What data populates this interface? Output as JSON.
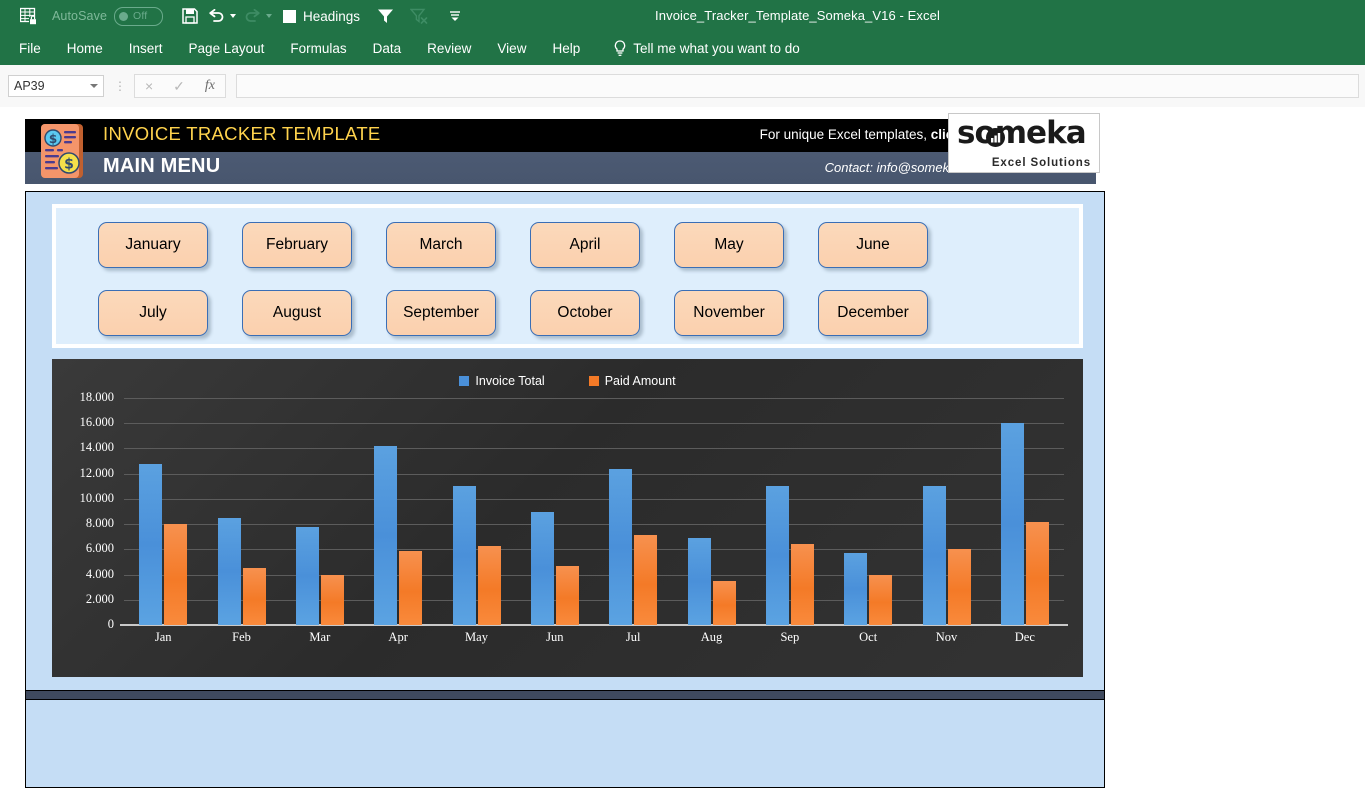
{
  "titlebar": {
    "autosave_label": "AutoSave",
    "autosave_state": "Off",
    "headings_label": "Headings",
    "window_title": "Invoice_Tracker_Template_Someka_V16  -  Excel",
    "icons": [
      "excel-lock-icon",
      "save-icon",
      "undo-icon",
      "redo-icon",
      "headings-checkbox",
      "filter-icon",
      "clear-filter-icon",
      "customize-qat-icon"
    ]
  },
  "ribbon": {
    "tabs": [
      "File",
      "Home",
      "Insert",
      "Page Layout",
      "Formulas",
      "Data",
      "Review",
      "View",
      "Help"
    ],
    "tellme": "Tell me what you want to do"
  },
  "formula_bar": {
    "name_box": "AP39",
    "cancel_icon": "×",
    "enter_icon": "✓",
    "function_icon": "fx",
    "formula_value": "",
    "formula_placeholder": ""
  },
  "banner": {
    "title": "INVOICE TRACKER TEMPLATE",
    "subtitle": "MAIN MENU",
    "promo_text": "For unique Excel templates, ",
    "promo_bold": "click →",
    "contact": "Contact: info@someka.net",
    "logo_word": "someka",
    "logo_sub": "Excel Solutions",
    "title_color": "#ffd34d",
    "top_bg": "#000000",
    "bottom_bg": "#4c5a73"
  },
  "months": {
    "row1": [
      "January",
      "February",
      "March",
      "April",
      "May",
      "June"
    ],
    "row2": [
      "July",
      "August",
      "September",
      "October",
      "November",
      "December"
    ],
    "button_fill": "#fbd3b1",
    "button_border": "#3a6eb5"
  },
  "chart_data": {
    "type": "bar",
    "title": "",
    "xlabel": "",
    "ylabel": "",
    "grid": true,
    "legend_position": "top",
    "background": "#333333",
    "ylim": [
      0,
      18000
    ],
    "yticks": [
      "0",
      "2.000",
      "4.000",
      "6.000",
      "8.000",
      "10.000",
      "12.000",
      "14.000",
      "16.000",
      "18.000"
    ],
    "categories": [
      "Jan",
      "Feb",
      "Mar",
      "Apr",
      "May",
      "Jun",
      "Jul",
      "Aug",
      "Sep",
      "Oct",
      "Nov",
      "Dec"
    ],
    "series": [
      {
        "name": "Invoice Total",
        "color": "#4a90d9",
        "values": [
          12800,
          8500,
          7800,
          14200,
          11000,
          9000,
          12400,
          6900,
          11000,
          5700,
          11000,
          16000
        ]
      },
      {
        "name": "Paid Amount",
        "color": "#f47a27",
        "values": [
          8000,
          4500,
          4000,
          5900,
          6300,
          4700,
          7100,
          3500,
          6400,
          4000,
          6000,
          8200
        ]
      }
    ]
  }
}
